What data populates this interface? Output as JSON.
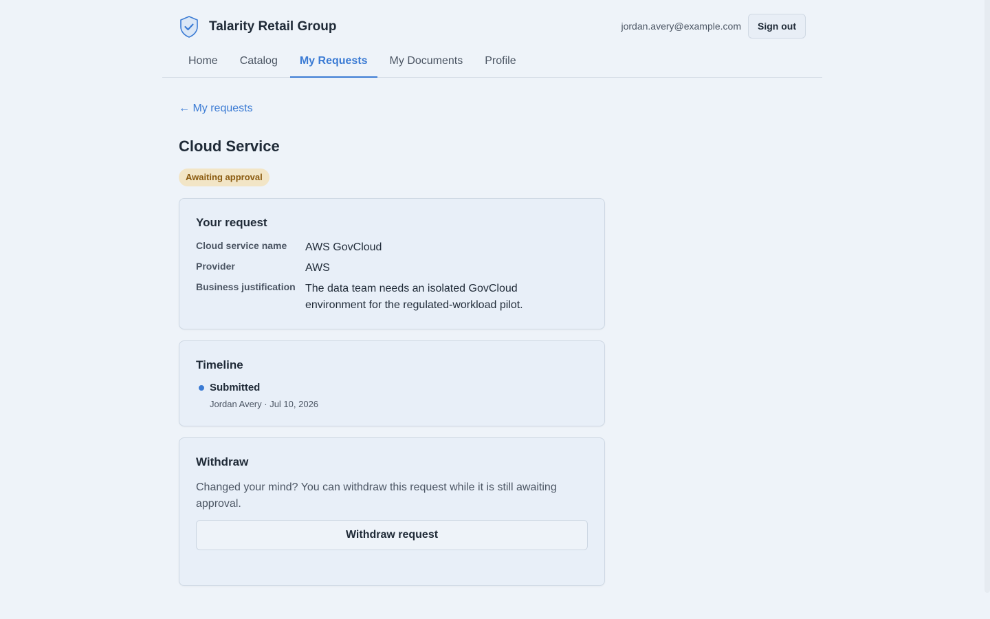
{
  "app": {
    "org_name": "Talarity Retail Group"
  },
  "header": {
    "user_email": "jordan.avery@example.com",
    "signout_label": "Sign out"
  },
  "nav": {
    "items": [
      {
        "label": "Home"
      },
      {
        "label": "Catalog"
      },
      {
        "label": "My Requests",
        "active": true
      },
      {
        "label": "My Documents"
      },
      {
        "label": "Profile"
      }
    ]
  },
  "page": {
    "back_link": "← My requests",
    "title": "Cloud Service",
    "status": "Awaiting approval"
  },
  "request": {
    "heading": "Your request",
    "fields": [
      {
        "label": "Cloud service name",
        "value": "AWS GovCloud"
      },
      {
        "label": "Provider",
        "value": "AWS"
      },
      {
        "label": "Business justification",
        "value": "The data team needs an isolated GovCloud environment for the regulated-workload pilot."
      }
    ]
  },
  "timeline": {
    "heading": "Timeline",
    "events": [
      {
        "title": "Submitted",
        "meta": "Jordan Avery · Jul 10, 2026"
      }
    ]
  },
  "withdraw": {
    "heading": "Withdraw",
    "text": "Changed your mind? You can withdraw this request while it is still awaiting approval.",
    "button_label": "Withdraw request"
  },
  "colors": {
    "accent": "#3b7bd4",
    "badge_bg": "#f2e5c6",
    "badge_text": "#8a5a0f",
    "page_bg": "#eef3f9"
  }
}
